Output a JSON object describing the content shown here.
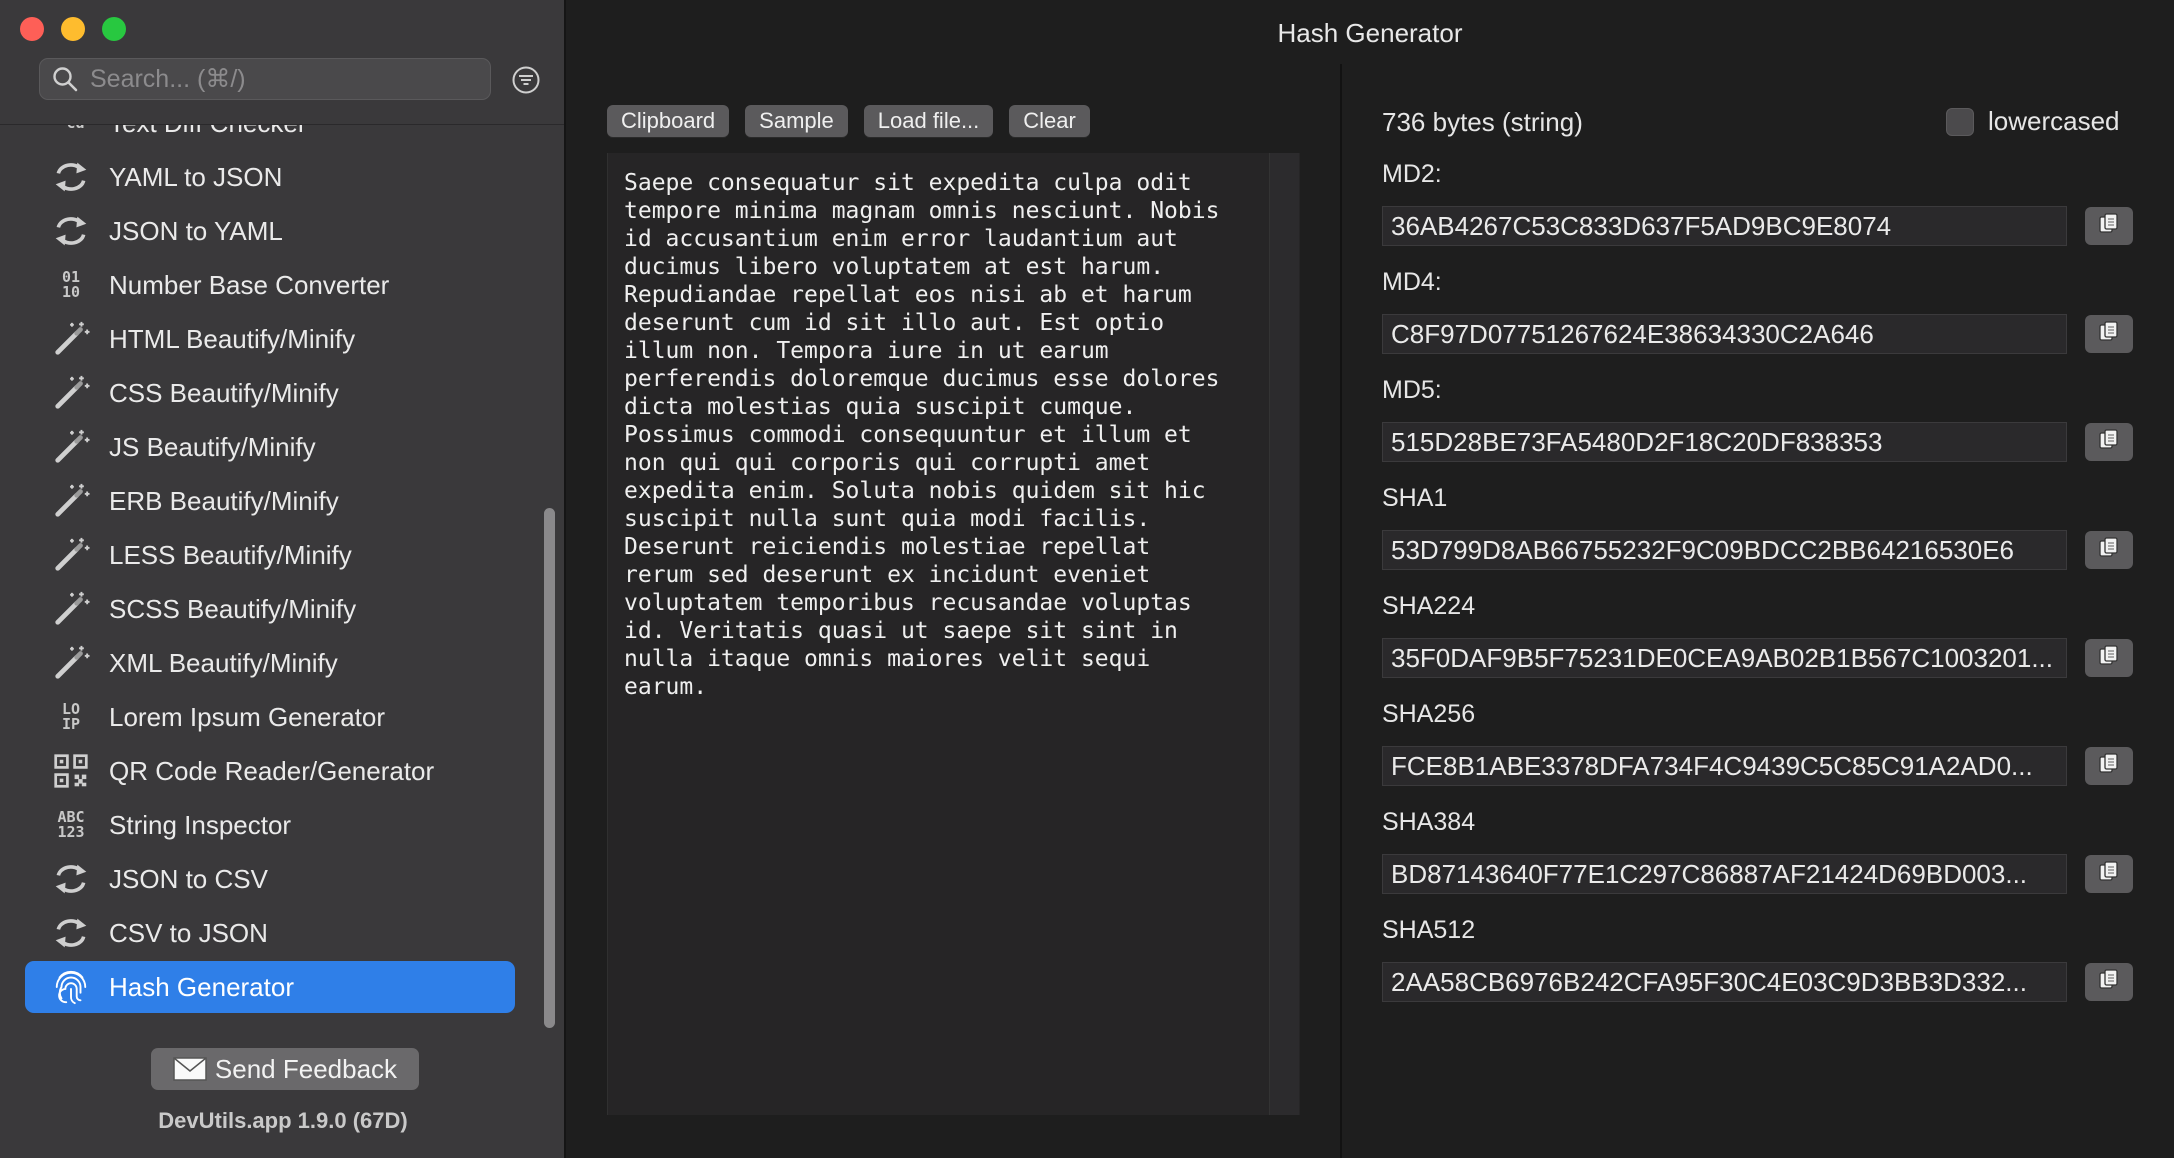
{
  "window": {
    "title": "Hash Generator"
  },
  "sidebar": {
    "search_placeholder": "Search... (⌘/)",
    "items": [
      {
        "label": "Text Diff Checker",
        "icon": "text-diff-icon",
        "glyph": "-cd"
      },
      {
        "label": "YAML to JSON",
        "icon": "convert-arrows-icon"
      },
      {
        "label": "JSON to YAML",
        "icon": "convert-arrows-icon"
      },
      {
        "label": "Number Base Converter",
        "icon": "number-base-icon",
        "glyph": "01\n10"
      },
      {
        "label": "HTML Beautify/Minify",
        "icon": "magic-wand-icon"
      },
      {
        "label": "CSS Beautify/Minify",
        "icon": "magic-wand-icon"
      },
      {
        "label": "JS Beautify/Minify",
        "icon": "magic-wand-icon"
      },
      {
        "label": "ERB Beautify/Minify",
        "icon": "magic-wand-icon"
      },
      {
        "label": "LESS Beautify/Minify",
        "icon": "magic-wand-icon"
      },
      {
        "label": "SCSS Beautify/Minify",
        "icon": "magic-wand-icon"
      },
      {
        "label": "XML Beautify/Minify",
        "icon": "magic-wand-icon"
      },
      {
        "label": "Lorem Ipsum Generator",
        "icon": "lorem-ipsum-icon",
        "glyph": "LO\nIP"
      },
      {
        "label": "QR Code Reader/Generator",
        "icon": "qr-code-icon"
      },
      {
        "label": "String Inspector",
        "icon": "string-inspector-icon",
        "glyph": "ABC\n123"
      },
      {
        "label": "JSON to CSV",
        "icon": "convert-arrows-icon"
      },
      {
        "label": "CSV to JSON",
        "icon": "convert-arrows-icon"
      },
      {
        "label": "Hash Generator",
        "icon": "fingerprint-icon",
        "selected": true
      }
    ],
    "feedback_label": "Send Feedback",
    "version": "DevUtils.app 1.9.0 (67D)"
  },
  "toolbar": {
    "clipboard": "Clipboard",
    "sample": "Sample",
    "load_file": "Load file...",
    "clear": "Clear"
  },
  "input_text": "Saepe consequatur sit expedita culpa odit\ntempore minima magnam omnis nesciunt. Nobis\nid accusantium enim error laudantium aut\nducimus libero voluptatem at est harum.\nRepudiandae repellat eos nisi ab et harum\ndeserunt cum id sit illo aut. Est optio\nillum non. Tempora iure in ut earum\nperferendis doloremque ducimus esse dolores\ndicta molestias quia suscipit cumque.\nPossimus commodi consequuntur et illum et\nnon qui qui corporis qui corrupti amet\nexpedita enim. Soluta nobis quidem sit hic\nsuscipit nulla sunt quia modi facilis.\nDeserunt reiciendis molestiae repellat\nrerum sed deserunt ex incidunt eveniet\nvoluptatem temporibus recusandae voluptas\nid. Veritatis quasi ut saepe sit sint in\nnulla itaque omnis maiores velit sequi\nearum.",
  "output": {
    "bytes": "736 bytes (string)",
    "lowercased_label": "lowercased",
    "lowercased_checked": false,
    "hashes": [
      {
        "label": "MD2:",
        "value": "36AB4267C53C833D637F5AD9BC9E8074"
      },
      {
        "label": "MD4:",
        "value": "C8F97D07751267624E38634330C2A646"
      },
      {
        "label": "MD5:",
        "value": "515D28BE73FA5480D2F18C20DF838353"
      },
      {
        "label": "SHA1",
        "value": "53D799D8AB66755232F9C09BDCC2BB64216530E6"
      },
      {
        "label": "SHA224",
        "value": "35F0DAF9B5F75231DE0CEA9AB02B1B567C1003201..."
      },
      {
        "label": "SHA256",
        "value": "FCE8B1ABE3378DFA734F4C9439C5C85C91A2AD0..."
      },
      {
        "label": "SHA384",
        "value": "BD87143640F77E1C297C86887AF21424D69BD003..."
      },
      {
        "label": "SHA512",
        "value": "2AA58CB6976B242CFA95F30C4E03C9D3BB3D332..."
      }
    ]
  },
  "colors": {
    "sidebar_bg": "#3a393b",
    "main_bg": "#1e1e1e",
    "selection": "#2f7fe8",
    "button_bg": "#5b5a5c"
  }
}
